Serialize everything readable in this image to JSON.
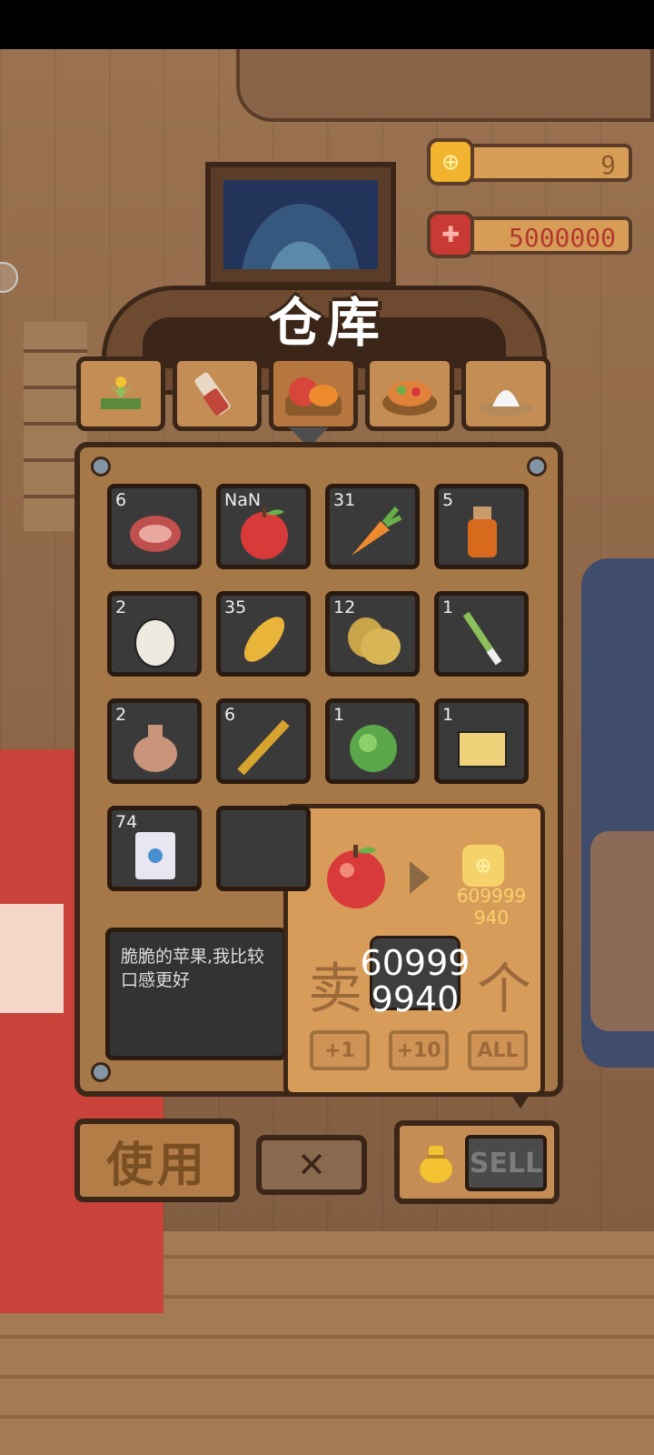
{
  "hud": {
    "gold_value": "9",
    "red_value": "5000000"
  },
  "panel": {
    "title": "仓库",
    "tabs": [
      {
        "name": "tab-plants",
        "icon": "plant-icon"
      },
      {
        "name": "tab-tools",
        "icon": "tool-icon"
      },
      {
        "name": "tab-produce",
        "icon": "produce-icon"
      },
      {
        "name": "tab-dishes",
        "icon": "dish-icon"
      },
      {
        "name": "tab-rice",
        "icon": "rice-bowl-icon"
      }
    ],
    "active_tab": 2,
    "items": [
      {
        "count": "6",
        "icon": "meat-icon",
        "color": "#c0504d"
      },
      {
        "count": "NaN",
        "icon": "apple-icon",
        "color": "#d83a3a"
      },
      {
        "count": "31",
        "icon": "carrot-icon",
        "color": "#ee8a2e"
      },
      {
        "count": "5",
        "icon": "honey-bottle-icon",
        "color": "#d86a1e"
      },
      {
        "count": "2",
        "icon": "egg-icon",
        "color": "#eeeae0"
      },
      {
        "count": "35",
        "icon": "corn-icon",
        "color": "#e8b43a"
      },
      {
        "count": "12",
        "icon": "potato-icon",
        "color": "#d9b655"
      },
      {
        "count": "1",
        "icon": "scallion-icon",
        "color": "#8cc05a"
      },
      {
        "count": "2",
        "icon": "seed-bag-icon",
        "color": "#c9957a"
      },
      {
        "count": "6",
        "icon": "wheat-icon",
        "color": "#d8a430"
      },
      {
        "count": "1",
        "icon": "lettuce-icon",
        "color": "#5aa84a"
      },
      {
        "count": "1",
        "icon": "tofu-icon",
        "color": "#f0d27a"
      },
      {
        "count": "74",
        "icon": "flour-bag-icon",
        "color": "#e8e6f0"
      },
      {
        "count": "",
        "icon": "",
        "color": ""
      }
    ],
    "description": "脆脆的苹果,我比较\n口感更好"
  },
  "sell_popup": {
    "price_line1": "609999",
    "price_line2": "940",
    "label_sell": "卖",
    "label_unit": "个",
    "qty_line1": "60999",
    "qty_line2": "9940",
    "btn_plus1": "+1",
    "btn_plus10": "+10",
    "btn_all": "ALL"
  },
  "bottom": {
    "use_label": "使用",
    "close_label": "✕",
    "sell_label": "SELL"
  }
}
